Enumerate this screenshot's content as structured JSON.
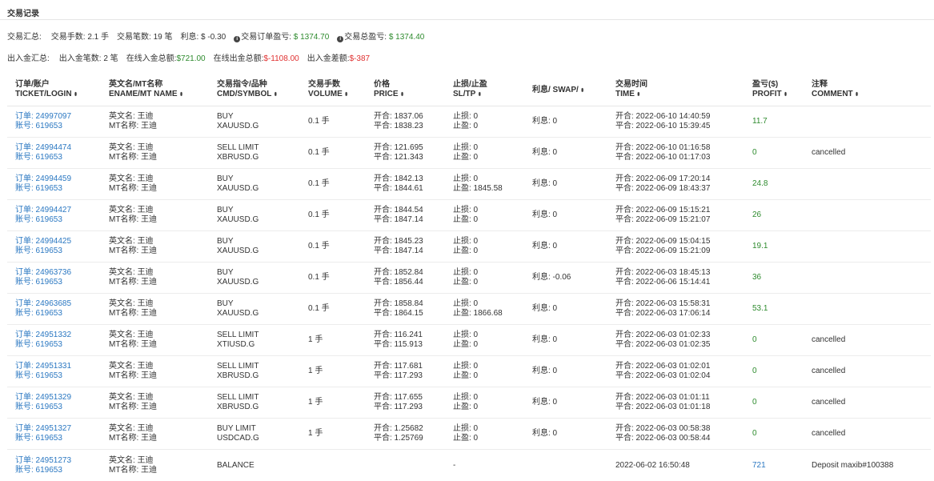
{
  "page_title": "交易记录",
  "trade_summary": {
    "label": "交易汇总:",
    "items": [
      {
        "text": "交易手数: 2.1 手",
        "value": ""
      },
      {
        "text": "交易笔数: 19 笔",
        "value": ""
      },
      {
        "text": "利息: $ -0.30",
        "value": ""
      }
    ],
    "order_profit_label": "交易订单盈亏:",
    "order_profit_value": "$ 1374.70",
    "total_profit_label": "交易总盈亏:",
    "total_profit_value": "$ 1374.40"
  },
  "cash_summary": {
    "label": "出入金汇总:",
    "count_text": "出入金笔数: 2 笔",
    "deposit_label": "在线入金总额:",
    "deposit_value": "$721.00",
    "withdraw_label": "在线出金总额:",
    "withdraw_value": "$-1108.00",
    "diff_label": "出入金差额:",
    "diff_value": "$-387"
  },
  "columns": [
    {
      "cn": "订单/账户",
      "en": "TICKET/LOGIN"
    },
    {
      "cn": "英文名/MT名称",
      "en": "ENAME/MT NAME"
    },
    {
      "cn": "交易指令/品种",
      "en": "CMD/SYMBOL"
    },
    {
      "cn": "交易手数",
      "en": "VOLUME"
    },
    {
      "cn": "价格",
      "en": "PRICE"
    },
    {
      "cn": "止损/止盈",
      "en": "SL/TP"
    },
    {
      "cn": "利息/ SWAP/",
      "en": ""
    },
    {
      "cn": "交易时间",
      "en": "TIME"
    },
    {
      "cn": "盈亏($)",
      "en": "PROFIT"
    },
    {
      "cn": "注释",
      "en": "COMMENT"
    }
  ],
  "sort_glyph": "⬍",
  "rows": [
    {
      "ticket": "订单: 24997097",
      "login": "账号: 619653",
      "ename": "英文名: 王迪",
      "mtname": "MT名称: 王迪",
      "cmd": "BUY",
      "symbol": "XAUUSD.G",
      "volume": "0.1 手",
      "open_price": "开合: 1837.06",
      "close_price": "平合: 1838.23",
      "sl": "止损: 0",
      "tp": "止盈: 0",
      "swap": "利息: 0",
      "open_time": "开合: 2022-06-10 14:40:59",
      "close_time": "平合: 2022-06-10 15:39:45",
      "profit": "11.7",
      "comment": ""
    },
    {
      "ticket": "订单: 24994474",
      "login": "账号: 619653",
      "ename": "英文名: 王迪",
      "mtname": "MT名称: 王迪",
      "cmd": "SELL LIMIT",
      "symbol": "XBRUSD.G",
      "volume": "0.1 手",
      "open_price": "开合: 121.695",
      "close_price": "平合: 121.343",
      "sl": "止损: 0",
      "tp": "止盈: 0",
      "swap": "利息: 0",
      "open_time": "开合: 2022-06-10 01:16:58",
      "close_time": "平合: 2022-06-10 01:17:03",
      "profit": "0",
      "comment": "cancelled"
    },
    {
      "ticket": "订单: 24994459",
      "login": "账号: 619653",
      "ename": "英文名: 王迪",
      "mtname": "MT名称: 王迪",
      "cmd": "BUY",
      "symbol": "XAUUSD.G",
      "volume": "0.1 手",
      "open_price": "开合: 1842.13",
      "close_price": "平合: 1844.61",
      "sl": "止损: 0",
      "tp": "止盈: 1845.58",
      "swap": "利息: 0",
      "open_time": "开合: 2022-06-09 17:20:14",
      "close_time": "平合: 2022-06-09 18:43:37",
      "profit": "24.8",
      "comment": ""
    },
    {
      "ticket": "订单: 24994427",
      "login": "账号: 619653",
      "ename": "英文名: 王迪",
      "mtname": "MT名称: 王迪",
      "cmd": "BUY",
      "symbol": "XAUUSD.G",
      "volume": "0.1 手",
      "open_price": "开合: 1844.54",
      "close_price": "平合: 1847.14",
      "sl": "止损: 0",
      "tp": "止盈: 0",
      "swap": "利息: 0",
      "open_time": "开合: 2022-06-09 15:15:21",
      "close_time": "平合: 2022-06-09 15:21:07",
      "profit": "26",
      "comment": ""
    },
    {
      "ticket": "订单: 24994425",
      "login": "账号: 619653",
      "ename": "英文名: 王迪",
      "mtname": "MT名称: 王迪",
      "cmd": "BUY",
      "symbol": "XAUUSD.G",
      "volume": "0.1 手",
      "open_price": "开合: 1845.23",
      "close_price": "平合: 1847.14",
      "sl": "止损: 0",
      "tp": "止盈: 0",
      "swap": "利息: 0",
      "open_time": "开合: 2022-06-09 15:04:15",
      "close_time": "平合: 2022-06-09 15:21:09",
      "profit": "19.1",
      "comment": ""
    },
    {
      "ticket": "订单: 24963736",
      "login": "账号: 619653",
      "ename": "英文名: 王迪",
      "mtname": "MT名称: 王迪",
      "cmd": "BUY",
      "symbol": "XAUUSD.G",
      "volume": "0.1 手",
      "open_price": "开合: 1852.84",
      "close_price": "平合: 1856.44",
      "sl": "止损: 0",
      "tp": "止盈: 0",
      "swap": "利息: -0.06",
      "open_time": "开合: 2022-06-03 18:45:13",
      "close_time": "平合: 2022-06-06 15:14:41",
      "profit": "36",
      "comment": ""
    },
    {
      "ticket": "订单: 24963685",
      "login": "账号: 619653",
      "ename": "英文名: 王迪",
      "mtname": "MT名称: 王迪",
      "cmd": "BUY",
      "symbol": "XAUUSD.G",
      "volume": "0.1 手",
      "open_price": "开合: 1858.84",
      "close_price": "平合: 1864.15",
      "sl": "止损: 0",
      "tp": "止盈: 1866.68",
      "swap": "利息: 0",
      "open_time": "开合: 2022-06-03 15:58:31",
      "close_time": "平合: 2022-06-03 17:06:14",
      "profit": "53.1",
      "comment": ""
    },
    {
      "ticket": "订单: 24951332",
      "login": "账号: 619653",
      "ename": "英文名: 王迪",
      "mtname": "MT名称: 王迪",
      "cmd": "SELL LIMIT",
      "symbol": "XTIUSD.G",
      "volume": "1 手",
      "open_price": "开合: 116.241",
      "close_price": "平合: 115.913",
      "sl": "止损: 0",
      "tp": "止盈: 0",
      "swap": "利息: 0",
      "open_time": "开合: 2022-06-03 01:02:33",
      "close_time": "平合: 2022-06-03 01:02:35",
      "profit": "0",
      "comment": "cancelled"
    },
    {
      "ticket": "订单: 24951331",
      "login": "账号: 619653",
      "ename": "英文名: 王迪",
      "mtname": "MT名称: 王迪",
      "cmd": "SELL LIMIT",
      "symbol": "XBRUSD.G",
      "volume": "1 手",
      "open_price": "开合: 117.681",
      "close_price": "平合: 117.293",
      "sl": "止损: 0",
      "tp": "止盈: 0",
      "swap": "利息: 0",
      "open_time": "开合: 2022-06-03 01:02:01",
      "close_time": "平合: 2022-06-03 01:02:04",
      "profit": "0",
      "comment": "cancelled"
    },
    {
      "ticket": "订单: 24951329",
      "login": "账号: 619653",
      "ename": "英文名: 王迪",
      "mtname": "MT名称: 王迪",
      "cmd": "SELL LIMIT",
      "symbol": "XBRUSD.G",
      "volume": "1 手",
      "open_price": "开合: 117.655",
      "close_price": "平合: 117.293",
      "sl": "止损: 0",
      "tp": "止盈: 0",
      "swap": "利息: 0",
      "open_time": "开合: 2022-06-03 01:01:11",
      "close_time": "平合: 2022-06-03 01:01:18",
      "profit": "0",
      "comment": "cancelled"
    },
    {
      "ticket": "订单: 24951327",
      "login": "账号: 619653",
      "ename": "英文名: 王迪",
      "mtname": "MT名称: 王迪",
      "cmd": "BUY LIMIT",
      "symbol": "USDCAD.G",
      "volume": "1 手",
      "open_price": "开合: 1.25682",
      "close_price": "平合: 1.25769",
      "sl": "止损: 0",
      "tp": "止盈: 0",
      "swap": "利息: 0",
      "open_time": "开合: 2022-06-03 00:58:38",
      "close_time": "平合: 2022-06-03 00:58:44",
      "profit": "0",
      "comment": "cancelled"
    },
    {
      "ticket": "订单: 24951273",
      "login": "账号: 619653",
      "ename": "英文名: 王迪",
      "mtname": "MT名称: 王迪",
      "cmd": "BALANCE",
      "symbol": "",
      "volume": "",
      "open_price": "",
      "close_price": "",
      "sl": "-",
      "tp": "",
      "swap": "",
      "open_time": "2022-06-02 16:50:48",
      "close_time": "",
      "profit": "721",
      "comment": "Deposit maxib#100388",
      "is_balance": true
    }
  ],
  "colors": {
    "positive": "#2e8b2e",
    "negative": "#e03030",
    "link": "#2b78c2"
  }
}
